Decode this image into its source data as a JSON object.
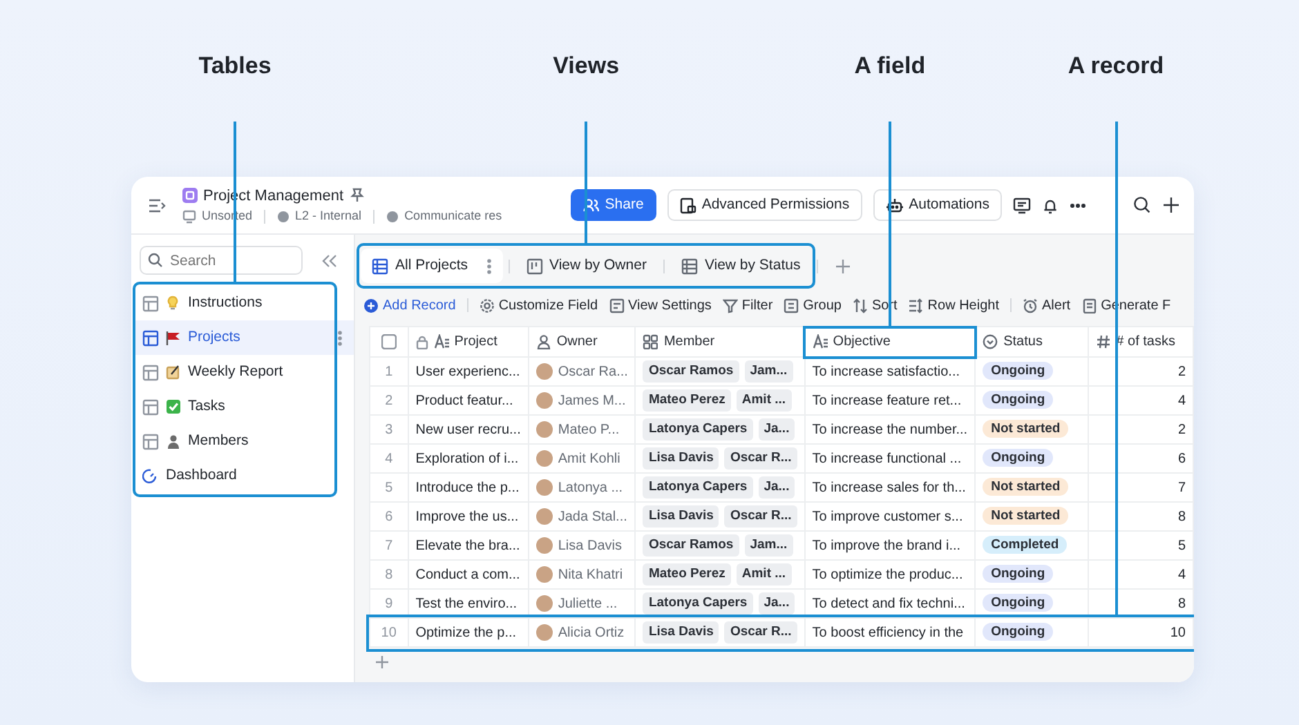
{
  "annotations": [
    {
      "label": "Tables",
      "kind": "sidebar"
    },
    {
      "label": "Views",
      "kind": "tabs"
    },
    {
      "label": "A field",
      "kind": "column"
    },
    {
      "label": "A record",
      "kind": "row"
    }
  ],
  "window": {
    "title": "Project Management",
    "meta": [
      "Unsorted",
      "L2 - Internal",
      "Communicate res"
    ],
    "buttons": [
      {
        "label": "Share",
        "kind": "primary"
      },
      {
        "label": "Advanced Permissions",
        "kind": "permissions"
      },
      {
        "label": "Automations",
        "kind": "automations"
      }
    ]
  },
  "sidebar": {
    "search": {
      "placeholder": "Search"
    },
    "items": [
      {
        "label": "Instructions",
        "kind": "table",
        "selected": false
      },
      {
        "label": "Projects",
        "kind": "table",
        "selected": true
      },
      {
        "label": "Weekly Report",
        "kind": "table",
        "selected": false
      },
      {
        "label": "Tasks",
        "kind": "table",
        "selected": false
      },
      {
        "label": "Members",
        "kind": "table",
        "selected": false
      },
      {
        "label": "Dashboard",
        "kind": "dashboard",
        "selected": false
      }
    ]
  },
  "tabs": [
    {
      "label": "All Projects",
      "selected": true
    },
    {
      "label": "View by Owner",
      "selected": false
    },
    {
      "label": "View by Status",
      "selected": false
    }
  ],
  "toolbar": [
    {
      "label": "Add Record",
      "kind": "add"
    },
    {
      "label": "Customize Field",
      "kind": "gear"
    },
    {
      "label": "View Settings",
      "kind": "settings"
    },
    {
      "label": "Filter",
      "kind": "filter"
    },
    {
      "label": "Group",
      "kind": "group"
    },
    {
      "label": "Sort",
      "kind": "sort"
    },
    {
      "label": "Row Height",
      "kind": "height"
    },
    {
      "label": "Alert",
      "kind": "alert"
    },
    {
      "label": "Generate F",
      "kind": "generate"
    }
  ],
  "table": {
    "select_all": {
      "checked": false
    },
    "columns": [
      {
        "label": "Project",
        "kind": "text",
        "highlighted": false
      },
      {
        "label": "Owner",
        "kind": "person",
        "highlighted": false
      },
      {
        "label": "Member",
        "kind": "people",
        "highlighted": false
      },
      {
        "label": "Objective",
        "kind": "text",
        "highlighted": true
      },
      {
        "label": "Status",
        "kind": "select",
        "highlighted": false
      },
      {
        "label": "# of tasks",
        "kind": "number",
        "highlighted": false
      }
    ],
    "rows": [
      {
        "number": "1",
        "project": "User experienc...",
        "owner": "Oscar Ra...",
        "members": [
          "Oscar Ramos",
          "Jam..."
        ],
        "objective": "To increase satisfactio...",
        "status": {
          "label": "Ongoing",
          "color": "#e1e7fb"
        },
        "tasks": "2",
        "highlighted": false
      },
      {
        "number": "2",
        "project": "Product featur...",
        "owner": "James M...",
        "members": [
          "Mateo Perez",
          "Amit ..."
        ],
        "objective": "To increase feature ret...",
        "status": {
          "label": "Ongoing",
          "color": "#e1e7fb"
        },
        "tasks": "4",
        "highlighted": false
      },
      {
        "number": "3",
        "project": "New user recru...",
        "owner": "Mateo P...",
        "members": [
          "Latonya Capers",
          "Ja..."
        ],
        "objective": "To increase the number...",
        "status": {
          "label": "Not started",
          "color": "#fce9d6"
        },
        "tasks": "2",
        "highlighted": false
      },
      {
        "number": "4",
        "project": "Exploration of i...",
        "owner": "Amit Kohli",
        "members": [
          "Lisa Davis",
          "Oscar R..."
        ],
        "objective": "To increase functional ...",
        "status": {
          "label": "Ongoing",
          "color": "#e1e7fb"
        },
        "tasks": "6",
        "highlighted": false
      },
      {
        "number": "5",
        "project": "Introduce the p...",
        "owner": "Latonya ...",
        "members": [
          "Latonya Capers",
          "Ja..."
        ],
        "objective": "To increase sales for th...",
        "status": {
          "label": "Not started",
          "color": "#fce9d6"
        },
        "tasks": "7",
        "highlighted": false
      },
      {
        "number": "6",
        "project": "Improve the us...",
        "owner": "Jada Stal...",
        "members": [
          "Lisa Davis",
          "Oscar R..."
        ],
        "objective": "To improve customer s...",
        "status": {
          "label": "Not started",
          "color": "#fce9d6"
        },
        "tasks": "8",
        "highlighted": false
      },
      {
        "number": "7",
        "project": "Elevate the bra...",
        "owner": "Lisa Davis",
        "members": [
          "Oscar Ramos",
          "Jam..."
        ],
        "objective": "To improve the brand i...",
        "status": {
          "label": "Completed",
          "color": "#d6eefb"
        },
        "tasks": "5",
        "highlighted": false
      },
      {
        "number": "8",
        "project": "Conduct a com...",
        "owner": "Nita Khatri",
        "members": [
          "Mateo Perez",
          "Amit ..."
        ],
        "objective": "To optimize the produc...",
        "status": {
          "label": "Ongoing",
          "color": "#e1e7fb"
        },
        "tasks": "4",
        "highlighted": false
      },
      {
        "number": "9",
        "project": "Test the enviro...",
        "owner": "Juliette ...",
        "members": [
          "Latonya Capers",
          "Ja..."
        ],
        "objective": "To detect and fix techni...",
        "status": {
          "label": "Ongoing",
          "color": "#e1e7fb"
        },
        "tasks": "8",
        "highlighted": false
      },
      {
        "number": "10",
        "project": "Optimize the p...",
        "owner": "Alicia Ortiz",
        "members": [
          "Lisa Davis",
          "Oscar R..."
        ],
        "objective": "To boost efficiency in the",
        "status": {
          "label": "Ongoing",
          "color": "#e1e7fb"
        },
        "tasks": "10",
        "highlighted": true
      }
    ]
  }
}
